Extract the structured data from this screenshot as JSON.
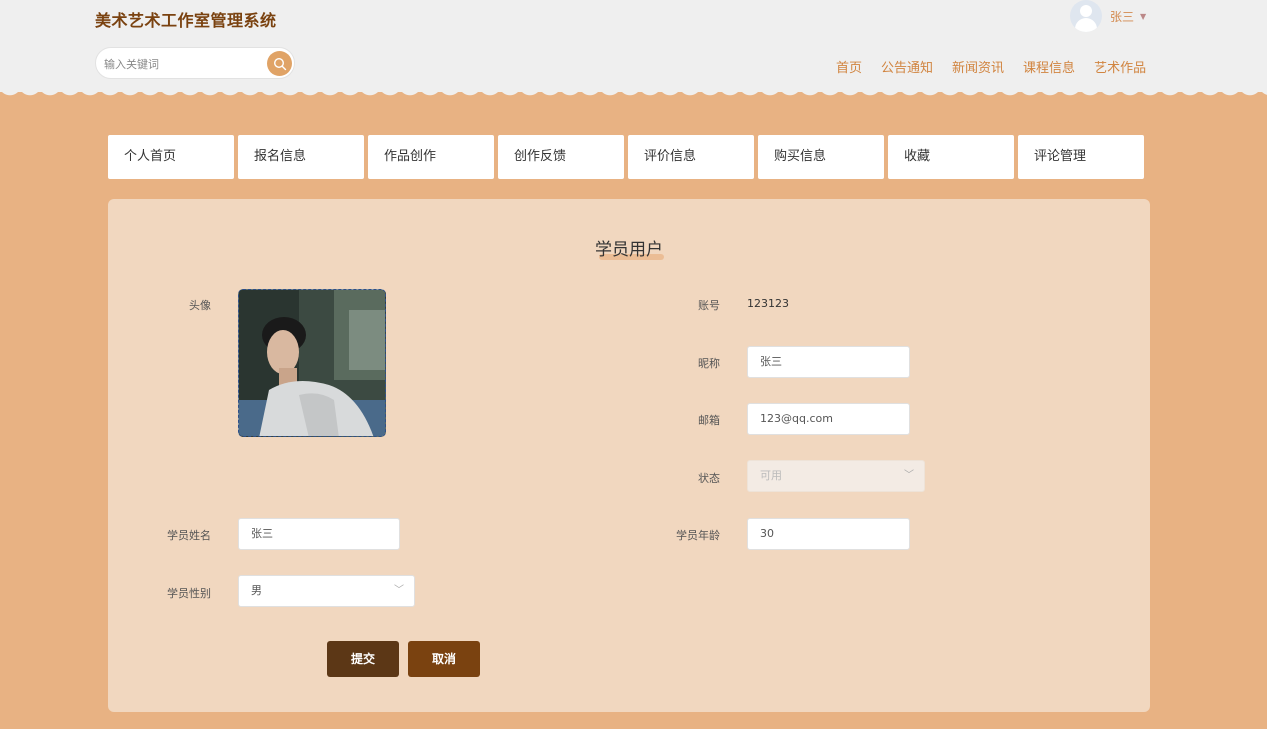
{
  "header": {
    "site_title": "美术艺术工作室管理系统",
    "search_placeholder": "输入关键词",
    "user_name": "张三",
    "nav": [
      "首页",
      "公告通知",
      "新闻资讯",
      "课程信息",
      "艺术作品"
    ]
  },
  "tabs": [
    "个人首页",
    "报名信息",
    "作品创作",
    "创作反馈",
    "评价信息",
    "购买信息",
    "收藏",
    "评论管理"
  ],
  "form": {
    "title": "学员用户",
    "avatar_label": "头像",
    "account_label": "账号",
    "account_value": "123123",
    "nickname_label": "昵称",
    "nickname_value": "张三",
    "email_label": "邮箱",
    "email_value": "123@qq.com",
    "status_label": "状态",
    "status_value": "可用",
    "name_label": "学员姓名",
    "name_value": "张三",
    "age_label": "学员年龄",
    "age_value": "30",
    "gender_label": "学员性别",
    "gender_value": "男",
    "submit_label": "提交",
    "cancel_label": "取消"
  },
  "colors": {
    "background": "#e8b283",
    "panel": "#f1d7bf",
    "header": "#efefef",
    "accent": "#d1843f",
    "submit": "#5c3716",
    "cancel": "#7a4210"
  }
}
